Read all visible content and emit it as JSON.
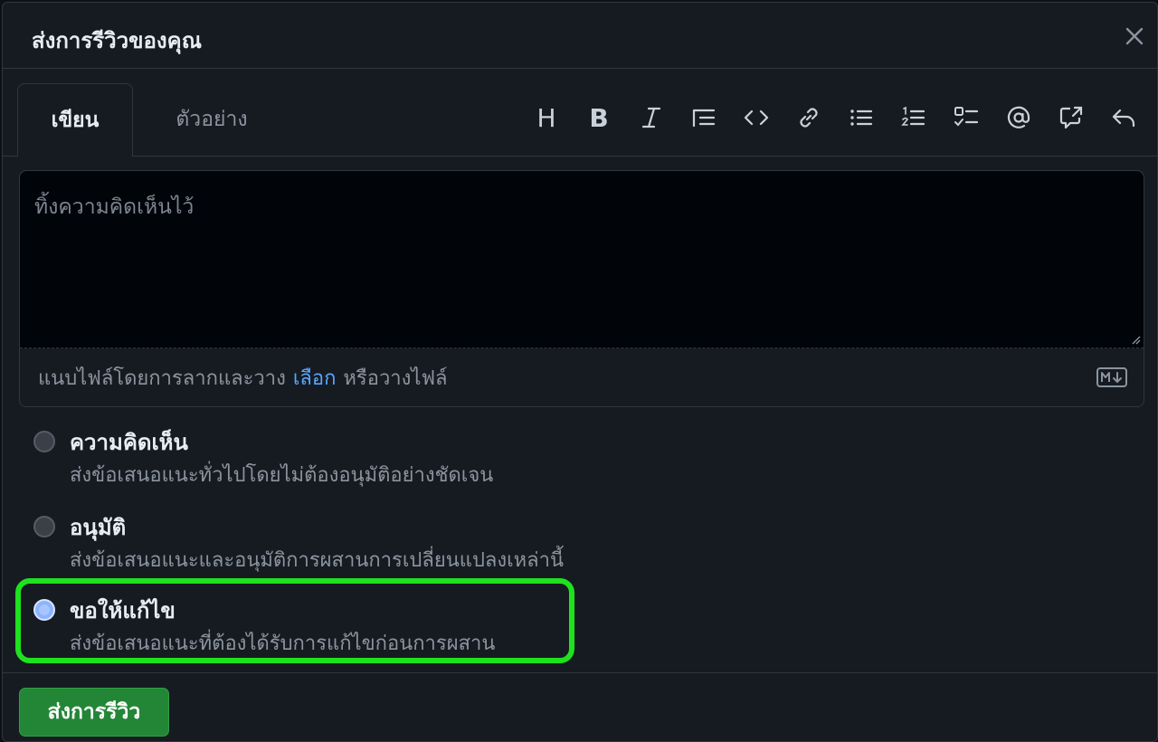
{
  "dialog": {
    "title": "ส่งการรีวิวของคุณ",
    "close_icon": "close-icon"
  },
  "tabs": [
    {
      "label": "เขียน",
      "active": true
    },
    {
      "label": "ตัวอย่าง",
      "active": false
    }
  ],
  "toolbar": {
    "items": [
      {
        "name": "heading",
        "glyph": "H"
      },
      {
        "name": "bold",
        "glyph": "B"
      },
      {
        "name": "italic",
        "icon": "italic-icon"
      },
      {
        "name": "quote",
        "icon": "quote-icon"
      },
      {
        "name": "code",
        "icon": "code-icon"
      },
      {
        "name": "link",
        "icon": "link-icon"
      },
      {
        "name": "unordered-list",
        "icon": "unordered-list-icon"
      },
      {
        "name": "ordered-list",
        "icon": "ordered-list-icon"
      },
      {
        "name": "task-list",
        "icon": "task-list-icon"
      },
      {
        "name": "mention",
        "icon": "mention-icon"
      },
      {
        "name": "reference",
        "icon": "cross-reference-icon"
      },
      {
        "name": "saved-replies",
        "icon": "reply-icon"
      }
    ]
  },
  "editor": {
    "placeholder": "ทิ้งความคิดเห็นไว้",
    "attach_prefix": "แนบไฟล์โดยการลากและวาง",
    "attach_link": "เลือก",
    "attach_suffix": "หรือวางไฟล์",
    "markdown_icon": "markdown-icon"
  },
  "review_options": [
    {
      "title": "ความคิดเห็น",
      "description": "ส่งข้อเสนอแนะทั่วไปโดยไม่ต้องอนุมัติอย่างชัดเจน",
      "selected": false
    },
    {
      "title": "อนุมัติ",
      "description": "ส่งข้อเสนอแนะและอนุมัติการผสานการเปลี่ยนแปลงเหล่านี้",
      "selected": false
    },
    {
      "title": "ขอให้แก้ไข",
      "description": "ส่งข้อเสนอแนะที่ต้องได้รับการแก้ไขก่อนการผสาน",
      "selected": true
    }
  ],
  "submit_label": "ส่งการรีวิว",
  "colors": {
    "background": "#161b22",
    "accent_link": "#58a6ff",
    "submit_green": "#238636",
    "highlight": "#1ee21e"
  }
}
